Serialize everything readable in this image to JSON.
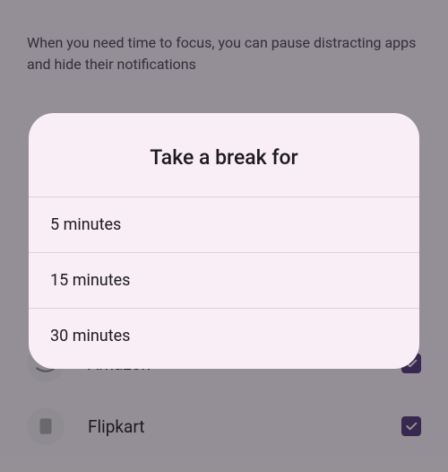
{
  "description": "When you need time to focus, you can pause distracting apps and hide their notifications",
  "apps": [
    {
      "name": "Amazon",
      "checked": true
    },
    {
      "name": "Flipkart",
      "checked": true
    }
  ],
  "dialog": {
    "title": "Take a break for",
    "options": [
      "5 minutes",
      "15 minutes",
      "30 minutes"
    ]
  }
}
